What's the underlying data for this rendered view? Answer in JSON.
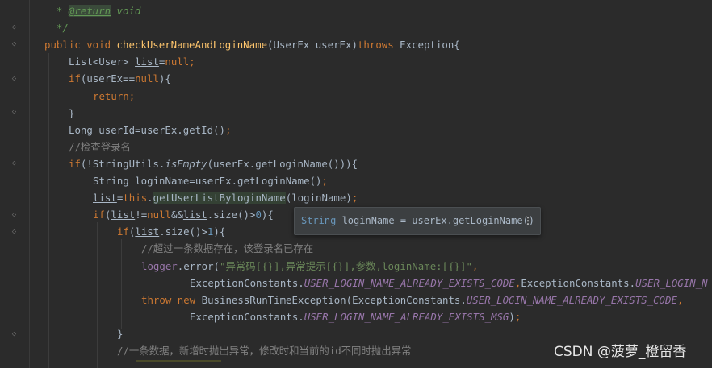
{
  "editor": {
    "lines": [
      {
        "indent": 0,
        "tokens": [
          {
            "c": "doc",
            "t": "  * "
          },
          {
            "c": "doctag",
            "t": "@return"
          },
          {
            "c": "doc",
            "t": " void"
          }
        ]
      },
      {
        "indent": 0,
        "tokens": [
          {
            "c": "doc",
            "t": "  */"
          }
        ]
      },
      {
        "indent": 0,
        "tokens": [
          {
            "c": "kw",
            "t": "public void "
          },
          {
            "c": "fn",
            "t": "checkUserNameAndLoginName"
          },
          {
            "c": "",
            "t": "(UserEx userEx)"
          },
          {
            "c": "kw",
            "t": "throws "
          },
          {
            "c": "",
            "t": "Exception{"
          }
        ]
      },
      {
        "indent": 1,
        "tokens": [
          {
            "c": "",
            "t": "List<User> "
          },
          {
            "c": "ul",
            "t": "list"
          },
          {
            "c": "",
            "t": "="
          },
          {
            "c": "kw",
            "t": "null"
          },
          {
            "c": "kw",
            "t": ";"
          }
        ]
      },
      {
        "indent": 1,
        "tokens": [
          {
            "c": "kw",
            "t": "if"
          },
          {
            "c": "",
            "t": "(userEx=="
          },
          {
            "c": "kw",
            "t": "null"
          },
          {
            "c": "",
            "t": "){"
          }
        ]
      },
      {
        "indent": 2,
        "tokens": [
          {
            "c": "kw",
            "t": "return;"
          }
        ]
      },
      {
        "indent": 1,
        "tokens": [
          {
            "c": "",
            "t": "}"
          }
        ]
      },
      {
        "indent": 1,
        "tokens": [
          {
            "c": "",
            "t": "Long userId=userEx.getId()"
          },
          {
            "c": "kw",
            "t": ";"
          }
        ]
      },
      {
        "indent": 1,
        "tokens": [
          {
            "c": "cm",
            "t": "//检查登录名"
          }
        ]
      },
      {
        "indent": 1,
        "tokens": [
          {
            "c": "kw",
            "t": "if"
          },
          {
            "c": "",
            "t": "(!StringUtils."
          },
          {
            "c": "sfn",
            "t": "isEmpty"
          },
          {
            "c": "",
            "t": "(userEx.getLoginName())){"
          }
        ]
      },
      {
        "indent": 2,
        "tokens": [
          {
            "c": "",
            "t": "String loginName=userEx.getLoginName()"
          },
          {
            "c": "kw",
            "t": ";"
          }
        ]
      },
      {
        "indent": 2,
        "tokens": [
          {
            "c": "ul",
            "t": "list"
          },
          {
            "c": "",
            "t": "="
          },
          {
            "c": "kw",
            "t": "this"
          },
          {
            "c": "",
            "t": "."
          },
          {
            "c": "hl",
            "t": "getUserListByloginName"
          },
          {
            "c": "",
            "t": "(loginName)"
          },
          {
            "c": "kw",
            "t": ";"
          }
        ]
      },
      {
        "indent": 2,
        "tokens": [
          {
            "c": "kw",
            "t": "if"
          },
          {
            "c": "",
            "t": "("
          },
          {
            "c": "ul",
            "t": "list"
          },
          {
            "c": "",
            "t": "!="
          },
          {
            "c": "kw",
            "t": "null"
          },
          {
            "c": "",
            "t": "&&"
          },
          {
            "c": "ul",
            "t": "list"
          },
          {
            "c": "",
            "t": ".size()>"
          },
          {
            "c": "num",
            "t": "0"
          },
          {
            "c": "",
            "t": "){"
          }
        ]
      },
      {
        "indent": 3,
        "tokens": [
          {
            "c": "kw",
            "t": "if"
          },
          {
            "c": "",
            "t": "("
          },
          {
            "c": "ul",
            "t": "list"
          },
          {
            "c": "",
            "t": ".size()>"
          },
          {
            "c": "num",
            "t": "1"
          },
          {
            "c": "",
            "t": "){"
          }
        ]
      },
      {
        "indent": 4,
        "tokens": [
          {
            "c": "cm",
            "t": "//超过一条数据存在，该登录名已存在"
          }
        ]
      },
      {
        "indent": 4,
        "tokens": [
          {
            "c": "const2",
            "t": "logger"
          },
          {
            "c": "",
            "t": ".error("
          },
          {
            "c": "str",
            "t": "\"异常码[{}],异常提示[{}],参数,loginName:[{}]\""
          },
          {
            "c": "kw",
            "t": ","
          }
        ]
      },
      {
        "indent": 6,
        "tokens": [
          {
            "c": "",
            "t": "ExceptionConstants."
          },
          {
            "c": "const",
            "t": "USER_LOGIN_NAME_ALREADY_EXISTS_CODE"
          },
          {
            "c": "kw",
            "t": ","
          },
          {
            "c": "",
            "t": "ExceptionConstants."
          },
          {
            "c": "const",
            "t": "USER_LOGIN_N"
          }
        ]
      },
      {
        "indent": 4,
        "tokens": [
          {
            "c": "kw",
            "t": "throw new "
          },
          {
            "c": "",
            "t": "BusinessRunTimeException(ExceptionConstants."
          },
          {
            "c": "const",
            "t": "USER_LOGIN_NAME_ALREADY_EXISTS_CODE"
          },
          {
            "c": "kw",
            "t": ","
          }
        ]
      },
      {
        "indent": 6,
        "tokens": [
          {
            "c": "",
            "t": "ExceptionConstants."
          },
          {
            "c": "const",
            "t": "USER_LOGIN_NAME_ALREADY_EXISTS_MSG"
          },
          {
            "c": "",
            "t": ")"
          },
          {
            "c": "kw",
            "t": ";"
          }
        ]
      },
      {
        "indent": 3,
        "tokens": [
          {
            "c": "",
            "t": "}"
          }
        ]
      },
      {
        "indent": 3,
        "tokens": [
          {
            "c": "cm",
            "t": "//一条数据，新增时抛出异常，修改时和当前的id不同时抛出异常"
          }
        ]
      }
    ]
  },
  "tooltip": {
    "type_keyword": "String",
    "text": " loginName = userEx.getLoginName()",
    "more_icon": "vertical-ellipsis-icon"
  },
  "watermark": "CSDN @菠萝_橙留香"
}
